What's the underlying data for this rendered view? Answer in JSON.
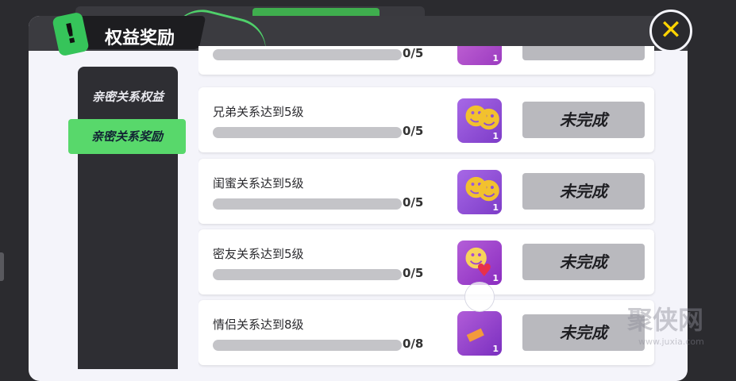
{
  "header": {
    "title": "权益奖励",
    "badge": "!",
    "close_glyph": "✕"
  },
  "sidebar": {
    "tabs": [
      {
        "label": "亲密关系权益",
        "active": false
      },
      {
        "label": "亲密关系奖励",
        "active": true
      }
    ]
  },
  "tasks": [
    {
      "label": "",
      "progress": "0/5",
      "button": "",
      "reward_count": "1",
      "reward_icon": "pink-item-icon"
    },
    {
      "label": "兄弟关系达到5级",
      "progress": "0/5",
      "button": "未完成",
      "reward_count": "1",
      "reward_icon": "brothers-icon"
    },
    {
      "label": "闺蜜关系达到5级",
      "progress": "0/5",
      "button": "未完成",
      "reward_count": "1",
      "reward_icon": "besties-icon"
    },
    {
      "label": "密友关系达到5级",
      "progress": "0/5",
      "button": "未完成",
      "reward_count": "1",
      "reward_icon": "close-friends-icon"
    },
    {
      "label": "情侣关系达到8级",
      "progress": "0/8",
      "button": "未完成",
      "reward_count": "1",
      "reward_icon": "couple-item-icon"
    }
  ],
  "watermark": {
    "title": "聚侠网",
    "url": "www.juxia.com"
  },
  "colors": {
    "accent_green": "#58d86b",
    "close_yellow": "#ffd400",
    "icon_purple": "#9b59d9"
  }
}
